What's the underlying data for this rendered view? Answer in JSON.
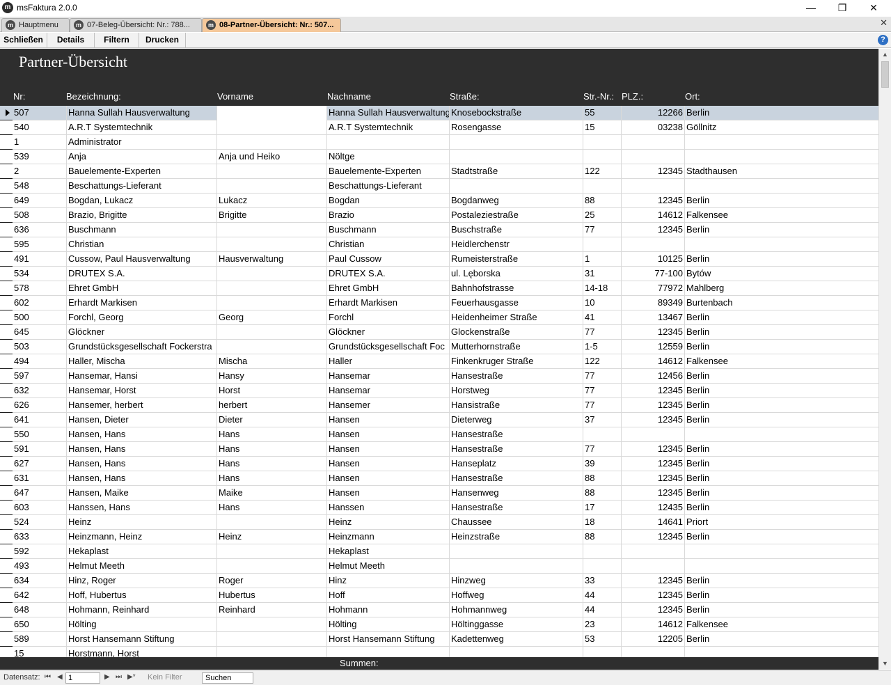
{
  "window": {
    "title": "msFaktura 2.0.0",
    "icon_letter": "m",
    "minimize": "—",
    "restore": "❐",
    "close": "✕"
  },
  "tabs": [
    {
      "label": "Hauptmenu"
    },
    {
      "label": "07-Beleg-Übersicht: Nr.: 788..."
    },
    {
      "label": "08-Partner-Übersicht: Nr.: 507..."
    }
  ],
  "tabs_close": "✕",
  "toolbar": {
    "close_label": "Schließen",
    "details_label": "Details",
    "filter_label": "Filtern",
    "print_label": "Drucken",
    "help": "?"
  },
  "page": {
    "title": "Partner-Übersicht"
  },
  "columns": {
    "nr": "Nr:",
    "bezeichnung": "Bezeichnung:",
    "vorname": "Vorname",
    "nachname": "Nachname",
    "strasse": "Straße:",
    "strnr": "Str.-Nr.:",
    "plz": "PLZ.:",
    "ort": "Ort:"
  },
  "rows": [
    {
      "nr": "507",
      "bez": " Hanna Sullah  Hausverwaltung",
      "vor": "",
      "nach": " Hanna Sullah  Hausverwaltung",
      "str": "Knosebockstraße",
      "snr": "55",
      "plz": "12266",
      "ort": "Berlin"
    },
    {
      "nr": "540",
      "bez": "A.R.T Systemtechnik",
      "vor": "",
      "nach": "A.R.T Systemtechnik",
      "str": "Rosengasse",
      "snr": "15",
      "plz": "03238",
      "ort": "Göllnitz"
    },
    {
      "nr": "1",
      "bez": "Administrator",
      "vor": "",
      "nach": "",
      "str": "",
      "snr": "",
      "plz": "",
      "ort": ""
    },
    {
      "nr": "539",
      "bez": "Anja",
      "vor": "Anja und Heiko",
      "nach": "Nöltge",
      "str": "",
      "snr": "",
      "plz": "",
      "ort": ""
    },
    {
      "nr": "2",
      "bez": "Bauelemente-Experten",
      "vor": "",
      "nach": "Bauelemente-Experten",
      "str": "Stadtstraße",
      "snr": "122",
      "plz": "12345",
      "ort": "Stadthausen"
    },
    {
      "nr": "548",
      "bez": "Beschattungs-Lieferant",
      "vor": "",
      "nach": "Beschattungs-Lieferant",
      "str": "",
      "snr": "",
      "plz": "",
      "ort": ""
    },
    {
      "nr": "649",
      "bez": "Bogdan, Lukacz",
      "vor": "Lukacz",
      "nach": "Bogdan",
      "str": "Bogdanweg",
      "snr": "88",
      "plz": "12345",
      "ort": "Berlin"
    },
    {
      "nr": "508",
      "bez": "Brazio, Brigitte",
      "vor": "Brigitte",
      "nach": "Brazio",
      "str": "Postaleziestraße",
      "snr": "25",
      "plz": "14612",
      "ort": "Falkensee"
    },
    {
      "nr": "636",
      "bez": "Buschmann",
      "vor": "",
      "nach": "Buschmann",
      "str": "Buschstraße",
      "snr": "77",
      "plz": "12345",
      "ort": "Berlin"
    },
    {
      "nr": "595",
      "bez": "Christian",
      "vor": "",
      "nach": "Christian",
      "str": "Heidlerchenstr",
      "snr": "",
      "plz": "",
      "ort": ""
    },
    {
      "nr": "491",
      "bez": "Cussow, Paul Hausverwaltung",
      "vor": "Hausverwaltung",
      "nach": "Paul Cussow",
      "str": "Rumeisterstraße",
      "snr": "1",
      "plz": "10125",
      "ort": "Berlin"
    },
    {
      "nr": "534",
      "bez": "DRUTEX S.A.",
      "vor": "",
      "nach": "DRUTEX S.A.",
      "str": "ul. Lęborska",
      "snr": "31",
      "plz": "77-100",
      "ort": "Bytów"
    },
    {
      "nr": "578",
      "bez": "Ehret GmbH",
      "vor": "",
      "nach": "Ehret GmbH",
      "str": "Bahnhofstrasse",
      "snr": "14-18",
      "plz": "77972",
      "ort": "Mahlberg"
    },
    {
      "nr": "602",
      "bez": "Erhardt Markisen",
      "vor": "",
      "nach": "Erhardt Markisen",
      "str": "Feuerhausgasse",
      "snr": "10",
      "plz": "89349",
      "ort": "Burtenbach"
    },
    {
      "nr": "500",
      "bez": "Forchl, Georg",
      "vor": "Georg",
      "nach": "Forchl",
      "str": "Heidenheimer Straße",
      "snr": "41",
      "plz": "13467",
      "ort": "Berlin"
    },
    {
      "nr": "645",
      "bez": "Glöckner",
      "vor": "",
      "nach": "Glöckner",
      "str": "Glockenstraße",
      "snr": "77",
      "plz": "12345",
      "ort": "Berlin"
    },
    {
      "nr": "503",
      "bez": "Grundstücksgesellschaft Fockerstra",
      "vor": "",
      "nach": "Grundstücksgesellschaft Foc",
      "str": "Mutterhornstraße",
      "snr": "1-5",
      "plz": "12559",
      "ort": "Berlin"
    },
    {
      "nr": "494",
      "bez": "Haller, Mischa",
      "vor": "Mischa",
      "nach": "Haller",
      "str": "Finkenkruger Straße",
      "snr": "122",
      "plz": "14612",
      "ort": "Falkensee"
    },
    {
      "nr": "597",
      "bez": "Hansemar, Hansi",
      "vor": "Hansy",
      "nach": "Hansemar",
      "str": "Hansestraße",
      "snr": "77",
      "plz": "12456",
      "ort": "Berlin"
    },
    {
      "nr": "632",
      "bez": "Hansemar, Horst",
      "vor": "Horst",
      "nach": "Hansemar",
      "str": "Horstweg",
      "snr": "77",
      "plz": "12345",
      "ort": "Berlin"
    },
    {
      "nr": "626",
      "bez": "Hansemer, herbert",
      "vor": "herbert",
      "nach": "Hansemer",
      "str": "Hansistraße",
      "snr": "77",
      "plz": "12345",
      "ort": "Berlin"
    },
    {
      "nr": "641",
      "bez": "Hansen, Dieter",
      "vor": "Dieter",
      "nach": "Hansen",
      "str": "Dieterweg",
      "snr": "37",
      "plz": "12345",
      "ort": "Berlin"
    },
    {
      "nr": "550",
      "bez": "Hansen, Hans",
      "vor": "Hans",
      "nach": "Hansen",
      "str": "Hansestraße",
      "snr": "",
      "plz": "",
      "ort": ""
    },
    {
      "nr": "591",
      "bez": "Hansen, Hans",
      "vor": "Hans",
      "nach": "Hansen",
      "str": "Hansestraße",
      "snr": "77",
      "plz": "12345",
      "ort": "Berlin"
    },
    {
      "nr": "627",
      "bez": "Hansen, Hans",
      "vor": "Hans",
      "nach": "Hansen",
      "str": "Hanseplatz",
      "snr": "39",
      "plz": "12345",
      "ort": "Berlin"
    },
    {
      "nr": "631",
      "bez": "Hansen, Hans",
      "vor": "Hans",
      "nach": "Hansen",
      "str": "Hansestraße",
      "snr": "88",
      "plz": "12345",
      "ort": "Berlin"
    },
    {
      "nr": "647",
      "bez": "Hansen, Maike",
      "vor": "Maike",
      "nach": "Hansen",
      "str": "Hansenweg",
      "snr": "88",
      "plz": "12345",
      "ort": "Berlin"
    },
    {
      "nr": "603",
      "bez": "Hanssen, Hans",
      "vor": "Hans",
      "nach": "Hanssen",
      "str": "Hansestraße",
      "snr": "17",
      "plz": "12435",
      "ort": "Berlin"
    },
    {
      "nr": "524",
      "bez": "Heinz",
      "vor": "",
      "nach": "Heinz",
      "str": "Chaussee",
      "snr": "18",
      "plz": "14641",
      "ort": "Priort"
    },
    {
      "nr": "633",
      "bez": "Heinzmann, Heinz",
      "vor": "Heinz",
      "nach": "Heinzmann",
      "str": "Heinzstraße",
      "snr": "88",
      "plz": "12345",
      "ort": "Berlin"
    },
    {
      "nr": "592",
      "bez": "Hekaplast",
      "vor": "",
      "nach": "Hekaplast",
      "str": "",
      "snr": "",
      "plz": "",
      "ort": ""
    },
    {
      "nr": "493",
      "bez": "Helmut Meeth",
      "vor": "",
      "nach": "Helmut Meeth",
      "str": "",
      "snr": "",
      "plz": "",
      "ort": ""
    },
    {
      "nr": "634",
      "bez": "Hinz, Roger",
      "vor": "Roger",
      "nach": "Hinz",
      "str": "Hinzweg",
      "snr": "33",
      "plz": "12345",
      "ort": "Berlin"
    },
    {
      "nr": "642",
      "bez": "Hoff, Hubertus",
      "vor": "Hubertus",
      "nach": "Hoff",
      "str": "Hoffweg",
      "snr": "44",
      "plz": "12345",
      "ort": "Berlin"
    },
    {
      "nr": "648",
      "bez": "Hohmann, Reinhard",
      "vor": "Reinhard",
      "nach": "Hohmann",
      "str": "Hohmannweg",
      "snr": "44",
      "plz": "12345",
      "ort": "Berlin"
    },
    {
      "nr": "650",
      "bez": "Hölting",
      "vor": "",
      "nach": "Hölting",
      "str": "Höltinggasse",
      "snr": "23",
      "plz": "14612",
      "ort": "Falkensee"
    },
    {
      "nr": "589",
      "bez": "Horst Hansemann Stiftung",
      "vor": "",
      "nach": "Horst Hansemann Stiftung",
      "str": "Kadettenweg",
      "snr": "53",
      "plz": "12205",
      "ort": "Berlin"
    },
    {
      "nr": "15",
      "bez": "Horstmann, Horst",
      "vor": "",
      "nach": "",
      "str": "",
      "snr": "",
      "plz": "",
      "ort": ""
    }
  ],
  "footer": {
    "sum_label": "Summen:"
  },
  "navigation": {
    "label": "Datensatz:",
    "first": "⏮",
    "prev": "◀",
    "current": "1",
    "next": "▶",
    "last": "⏭",
    "new": "▶*",
    "filter_status": "Kein Filter",
    "search_placeholder": "Suchen"
  },
  "scrollbar": {
    "up": "▲",
    "down": "▼"
  },
  "colors": {
    "header_bg": "#2e2e2e",
    "selected_row": "#c9d3de",
    "active_tab": "#f5c89a"
  }
}
